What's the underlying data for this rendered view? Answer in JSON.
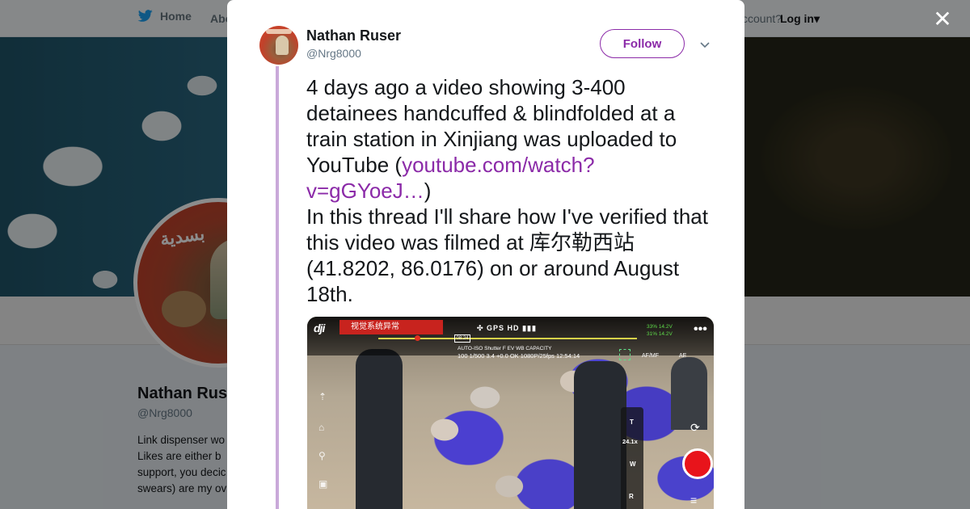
{
  "background": {
    "nav": {
      "home_label": "Home",
      "about_label": "Abo",
      "account_text": "ccount?",
      "login_label": "Log in"
    },
    "profile": {
      "name": "Nathan Rus",
      "handle": "@Nrg8000",
      "bio_lines": [
        "Link dispenser wo",
        "Likes are either b",
        "support, you decic",
        "swears) are my ov"
      ]
    }
  },
  "tweet": {
    "author_name": "Nathan Ruser",
    "author_handle": "@Nrg8000",
    "follow_label": "Follow",
    "text_part1": "4 days ago a video showing 3-400 detainees handcuffed & blindfolded at a train station in Xinjiang was uploaded to YouTube (",
    "link_text": "youtube.com/watch?v=gGYoeJ…",
    "text_part2": ")",
    "text_part3": "In this thread I'll share how I've verified that this video was filmed at 库尔勒西站 (41.8202, 86.0176) on or around August 18th."
  },
  "media": {
    "logo": "dji",
    "warning": "视觉系统异常",
    "time_marker": "08:24",
    "status_icons": "GPS  HD",
    "battery_top": "33%  14.2V",
    "battery_bottom": "31%  14.2V",
    "mode_row": "AUTO-ISO  Shutter   F    EV   WB    CAPACITY",
    "values_row": "100   1/500  3.4  +0.0  OK      1080P/25fps  12:54:14",
    "af_label": "AF/MF",
    "ae_label": "AE",
    "zoom_t": "T",
    "zoom_value": "24.1x",
    "zoom_w": "W",
    "zoom_r": "R"
  },
  "colors": {
    "accent": "#8b2aa8",
    "thread_line": "#c9a9d9",
    "record": "#e8141b"
  }
}
